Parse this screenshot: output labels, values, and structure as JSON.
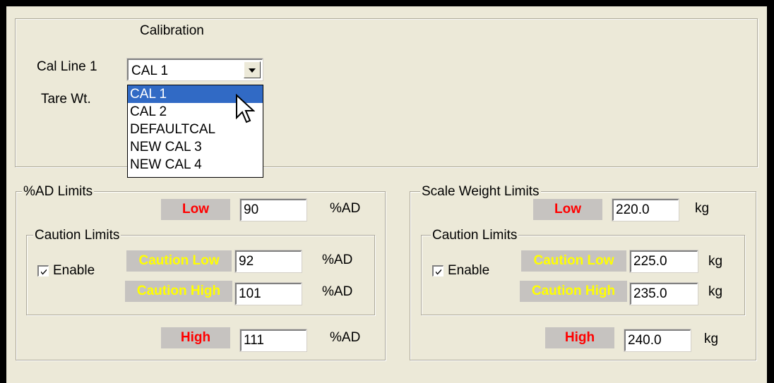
{
  "calibration": {
    "title": "Calibration",
    "cal_line_label": "Cal Line 1",
    "tare_label": "Tare Wt.",
    "selected": "CAL 1",
    "options": [
      "CAL 1",
      "CAL 2",
      "DEFAULTCAL",
      "NEW CAL 3",
      "NEW CAL 4"
    ],
    "highlighted_index": 0
  },
  "ad_limits": {
    "title": "%AD  Limits",
    "low_label": "Low",
    "low_value": "90",
    "low_unit": "%AD",
    "caution": {
      "title": "Caution Limits",
      "enable_label": "Enable",
      "enabled": true,
      "low_label": "Caution Low",
      "low_value": "92",
      "low_unit": "%AD",
      "high_label": "Caution High",
      "high_value": "101",
      "high_unit": "%AD"
    },
    "high_label": "High",
    "high_value": "111",
    "high_unit": "%AD"
  },
  "scale_limits": {
    "title": "Scale Weight Limits",
    "low_label": "Low",
    "low_value": "220.0",
    "low_unit": "kg",
    "caution": {
      "title": "Caution Limits",
      "enable_label": "Enable",
      "enabled": true,
      "low_label": "Caution Low",
      "low_value": "225.0",
      "low_unit": "kg",
      "high_label": "Caution High",
      "high_value": "235.0",
      "high_unit": "kg"
    },
    "high_label": "High",
    "high_value": "240.0",
    "high_unit": "kg"
  },
  "colors": {
    "panel": "#ece9d8",
    "limit_label": "#ff0000",
    "caution_label": "#ffff00",
    "selection": "#316ac5"
  }
}
